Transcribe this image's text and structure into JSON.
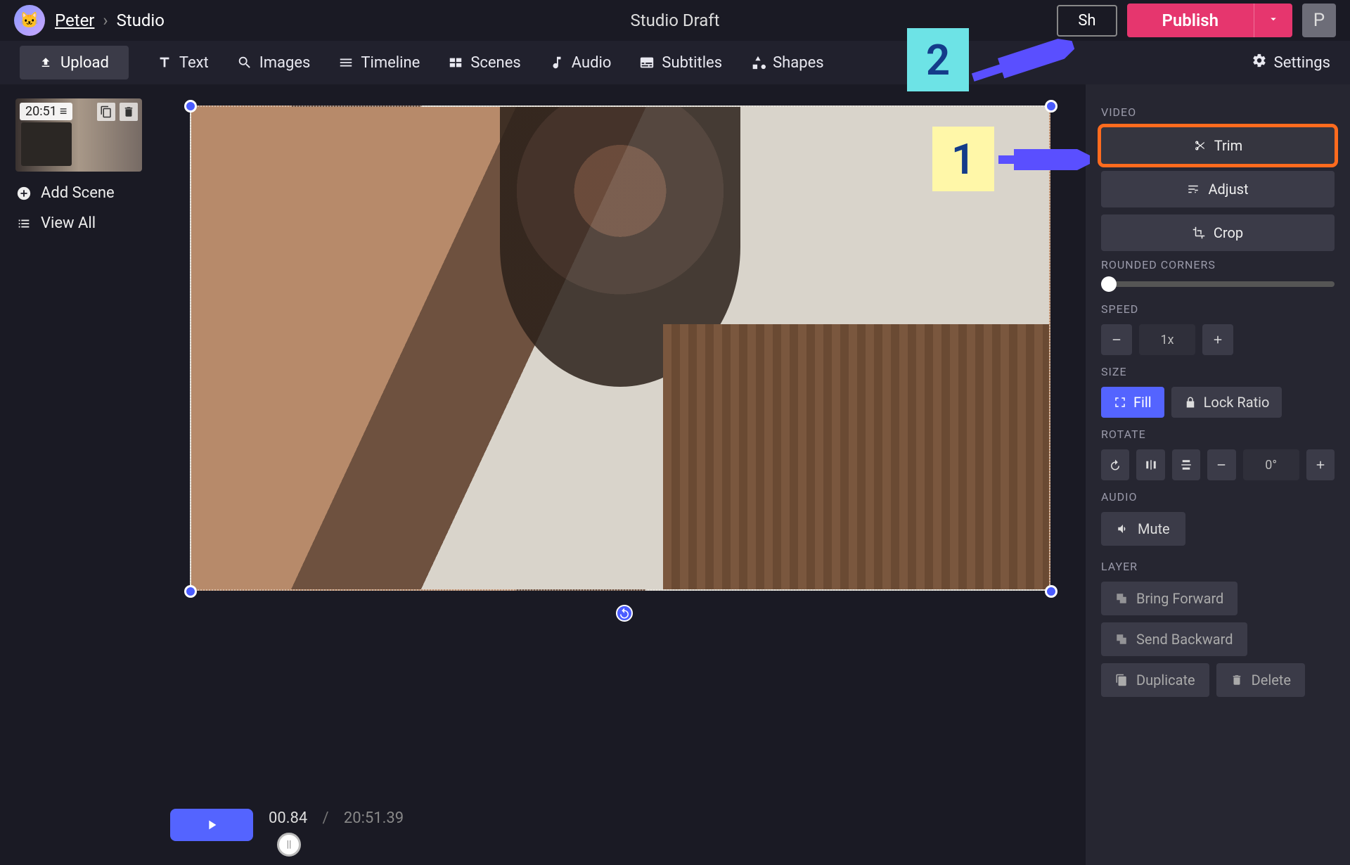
{
  "breadcrumb": {
    "user": "Peter",
    "section": "Studio"
  },
  "project_title": "Studio Draft",
  "top": {
    "share": "Sh",
    "publish": "Publish",
    "user_initial": "P"
  },
  "toolbar": {
    "upload": "Upload",
    "text": "Text",
    "images": "Images",
    "timeline": "Timeline",
    "scenes": "Scenes",
    "audio": "Audio",
    "subtitles": "Subtitles",
    "shapes": "Shapes",
    "settings": "Settings"
  },
  "scenes": {
    "duration": "20:51",
    "add": "Add Scene",
    "view_all": "View All"
  },
  "playbar": {
    "current": "00.84",
    "total": "20:51.39"
  },
  "panel": {
    "video": {
      "label": "VIDEO",
      "trim": "Trim",
      "adjust": "Adjust",
      "crop": "Crop"
    },
    "rounded": {
      "label": "ROUNDED CORNERS"
    },
    "speed": {
      "label": "SPEED",
      "value": "1x"
    },
    "size": {
      "label": "SIZE",
      "fill": "Fill",
      "lock": "Lock Ratio"
    },
    "rotate": {
      "label": "ROTATE",
      "angle": "0°"
    },
    "audio": {
      "label": "AUDIO",
      "mute": "Mute"
    },
    "layer": {
      "label": "LAYER",
      "forward": "Bring Forward",
      "backward": "Send Backward",
      "duplicate": "Duplicate",
      "delete": "Delete"
    }
  },
  "annotations": {
    "step1": "1",
    "step2": "2"
  }
}
